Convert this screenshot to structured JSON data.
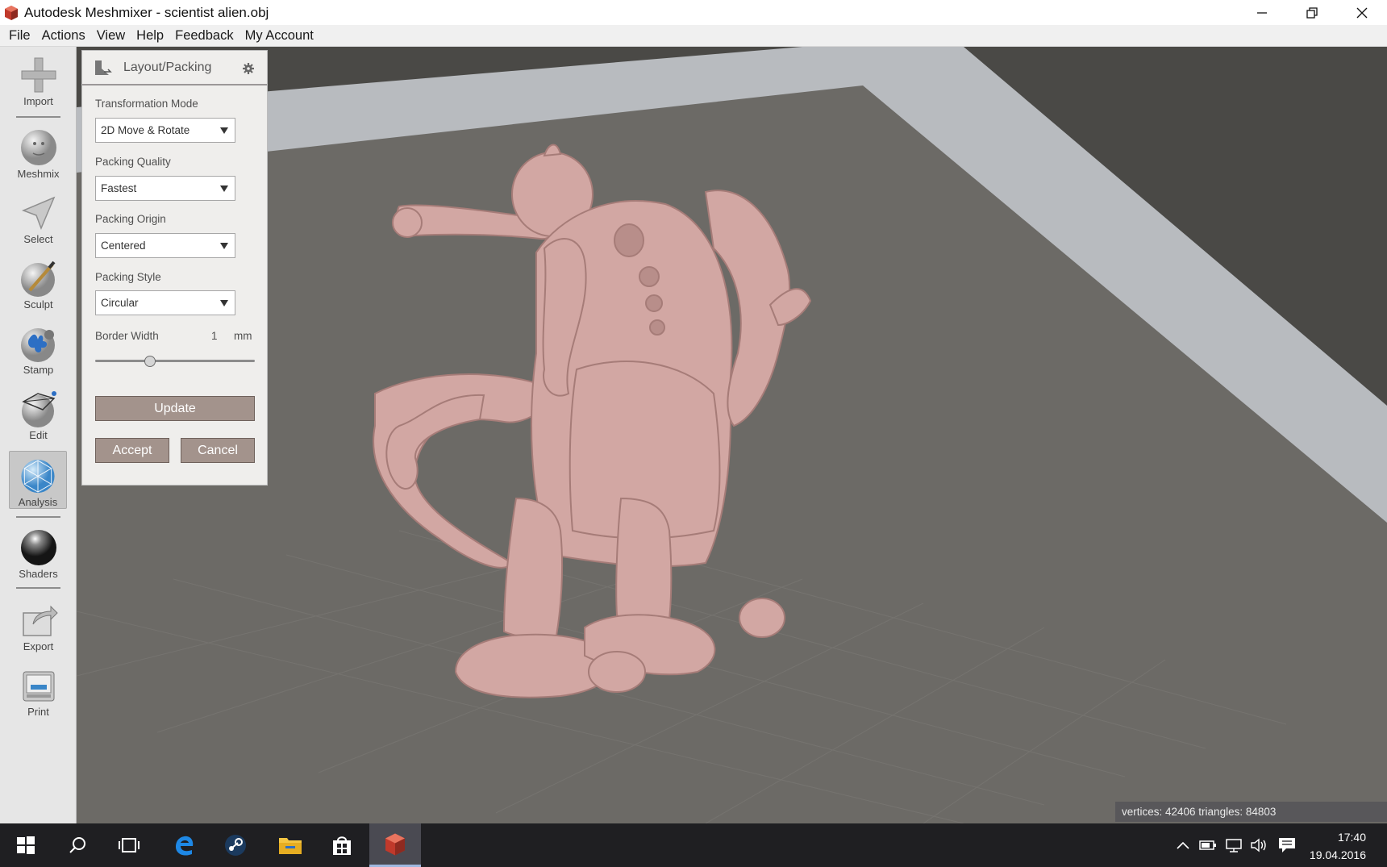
{
  "window": {
    "title": "Autodesk Meshmixer - scientist alien.obj"
  },
  "menu": [
    "File",
    "Actions",
    "View",
    "Help",
    "Feedback",
    "My Account"
  ],
  "tools": [
    {
      "label": "Import",
      "icon": "plus-icon"
    },
    {
      "label": "Meshmix",
      "icon": "meshmix-icon"
    },
    {
      "label": "Select",
      "icon": "select-arrow-icon"
    },
    {
      "label": "Sculpt",
      "icon": "sculpt-brush-icon"
    },
    {
      "label": "Stamp",
      "icon": "stamp-icon"
    },
    {
      "label": "Edit",
      "icon": "edit-mesh-icon"
    },
    {
      "label": "Analysis",
      "icon": "analysis-icon"
    },
    {
      "label": "Shaders",
      "icon": "shader-sphere-icon"
    },
    {
      "label": "Export",
      "icon": "export-icon"
    },
    {
      "label": "Print",
      "icon": "printer-icon"
    }
  ],
  "active_tool": "Analysis",
  "panel": {
    "title": "Layout/Packing",
    "transformation_mode": {
      "label": "Transformation Mode",
      "value": "2D Move & Rotate"
    },
    "packing_quality": {
      "label": "Packing Quality",
      "value": "Fastest"
    },
    "packing_origin": {
      "label": "Packing Origin",
      "value": "Centered"
    },
    "packing_style": {
      "label": "Packing Style",
      "value": "Circular"
    },
    "border_width": {
      "label": "Border Width",
      "value": "1",
      "unit": "mm",
      "slider_fraction": 0.33
    },
    "update_label": "Update",
    "accept_label": "Accept",
    "cancel_label": "Cancel"
  },
  "stats": "vertices: 42406 triangles: 84803",
  "taskbar": {
    "time": "17:40",
    "date": "19.04.2016"
  },
  "colors": {
    "model": "#d2a7a3",
    "bed": "#6c6a66",
    "bed_frame": "#b9bcc0",
    "button": "#a3938c"
  }
}
